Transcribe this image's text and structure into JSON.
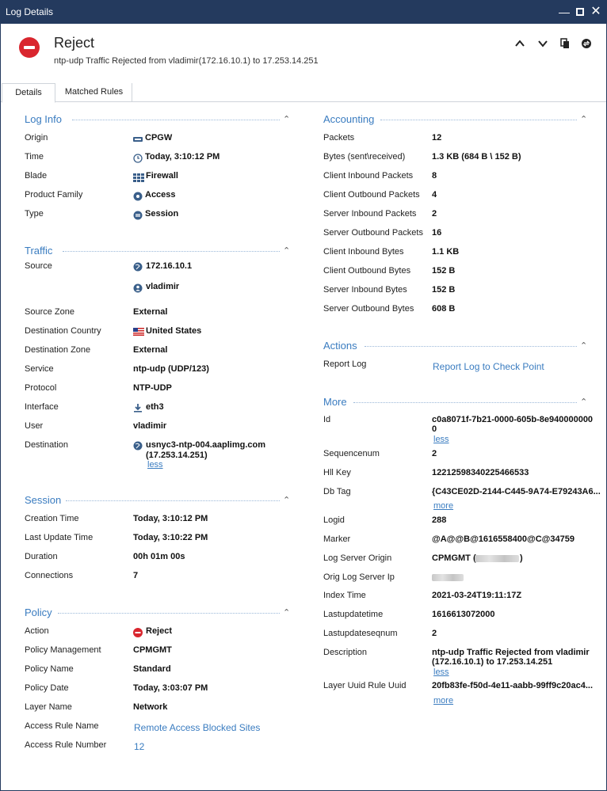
{
  "window": {
    "title": "Log Details"
  },
  "header": {
    "title": "Reject",
    "subtitle": "ntp-udp Traffic Rejected from vladimir(172.16.10.1) to 17.253.14.251"
  },
  "tabs": [
    {
      "label": "Details"
    },
    {
      "label": "Matched Rules"
    }
  ],
  "colors": {
    "accent": "#3a7cc0",
    "reject": "#d9262e",
    "titlebar": "#243a5e"
  },
  "log_info": {
    "title": "Log Info",
    "rows": [
      {
        "label": "Origin",
        "value": "CPGW",
        "icon": "gateway-icon"
      },
      {
        "label": "Time",
        "value": "Today, 3:10:12 PM",
        "icon": "clock-icon"
      },
      {
        "label": "Blade",
        "value": "Firewall",
        "icon": "firewall-icon"
      },
      {
        "label": "Product Family",
        "value": "Access",
        "icon": "access-icon"
      },
      {
        "label": "Type",
        "value": "Session",
        "icon": "session-icon"
      }
    ]
  },
  "traffic": {
    "title": "Traffic",
    "source_label": "Source",
    "source_ip": "172.16.10.1",
    "source_user": "vladimir",
    "source_zone_label": "Source Zone",
    "source_zone": "External",
    "dest_country_label": "Destination Country",
    "dest_country": "United States",
    "dest_zone_label": "Destination Zone",
    "dest_zone": "External",
    "service_label": "Service",
    "service": "ntp-udp (UDP/123)",
    "protocol_label": "Protocol",
    "protocol": "NTP-UDP",
    "interface_label": "Interface",
    "interface": "eth3",
    "user_label": "User",
    "user": "vladimir",
    "destination_label": "Destination",
    "destination_host": "usnyc3-ntp-004.aaplimg.com",
    "destination_ip": "(17.253.14.251)",
    "less": "less"
  },
  "session": {
    "title": "Session",
    "rows": [
      {
        "label": "Creation Time",
        "value": "Today, 3:10:12 PM"
      },
      {
        "label": "Last Update Time",
        "value": "Today, 3:10:22 PM"
      },
      {
        "label": "Duration",
        "value": "00h 01m 00s"
      },
      {
        "label": "Connections",
        "value": "7"
      }
    ]
  },
  "policy": {
    "title": "Policy",
    "action_label": "Action",
    "action": "Reject",
    "mgmt_label": "Policy Management",
    "mgmt": "CPMGMT",
    "name_label": "Policy Name",
    "name": "Standard",
    "date_label": "Policy Date",
    "date": "Today, 3:03:07 PM",
    "layer_label": "Layer Name",
    "layer": "Network",
    "rule_name_label": "Access Rule Name",
    "rule_name": "Remote Access Blocked Sites",
    "rule_number_label": "Access Rule Number",
    "rule_number": "12"
  },
  "accounting": {
    "title": "Accounting",
    "rows": [
      {
        "label": "Packets",
        "value": "12"
      },
      {
        "label": "Bytes (sent\\received)",
        "value": "1.3 KB (684 B \\ 152 B)"
      },
      {
        "label": "Client Inbound Packets",
        "value": "8"
      },
      {
        "label": "Client Outbound Packets",
        "value": "4"
      },
      {
        "label": "Server Inbound Packets",
        "value": "2"
      },
      {
        "label": "Server Outbound Packets",
        "value": "16"
      },
      {
        "label": "Client Inbound Bytes",
        "value": "1.1 KB"
      },
      {
        "label": "Client Outbound Bytes",
        "value": "152 B"
      },
      {
        "label": "Server Inbound Bytes",
        "value": "152 B"
      },
      {
        "label": "Server Outbound Bytes",
        "value": "608 B"
      }
    ]
  },
  "actions": {
    "title": "Actions",
    "report_label": "Report Log",
    "report_link": "Report Log to Check Point"
  },
  "more": {
    "title": "More",
    "id_label": "Id",
    "id_line1": "c0a8071f-7b21-0000-605b-8e940000000",
    "id_line2": "0",
    "less": "less",
    "more": "more",
    "seq_label": "Sequencenum",
    "seq": "2",
    "hll_label": "Hll Key",
    "hll": "12212598340225466533",
    "dbtag_label": "Db Tag",
    "dbtag": "{C43CE02D-2144-C445-9A74-E79243A6...",
    "logid_label": "Logid",
    "logid": "288",
    "marker_label": "Marker",
    "marker": "@A@@B@1616558400@C@34759",
    "lso_label": "Log Server Origin",
    "lso_prefix": "CPMGMT (",
    "lso_suffix": ")",
    "olsi_label": "Orig Log Server Ip",
    "index_label": "Index Time",
    "index": "2021-03-24T19:11:17Z",
    "lut_label": "Lastupdatetime",
    "lut": "1616613072000",
    "lus_label": "Lastupdateseqnum",
    "lus": "2",
    "desc_label": "Description",
    "desc_line1": "ntp-udp Traffic Rejected from vladimir",
    "desc_line2": "(172.16.10.1) to 17.253.14.251",
    "layer_label": "Layer Uuid Rule Uuid",
    "layer": "20fb83fe-f50d-4e11-aabb-99ff9c20ac4..."
  }
}
